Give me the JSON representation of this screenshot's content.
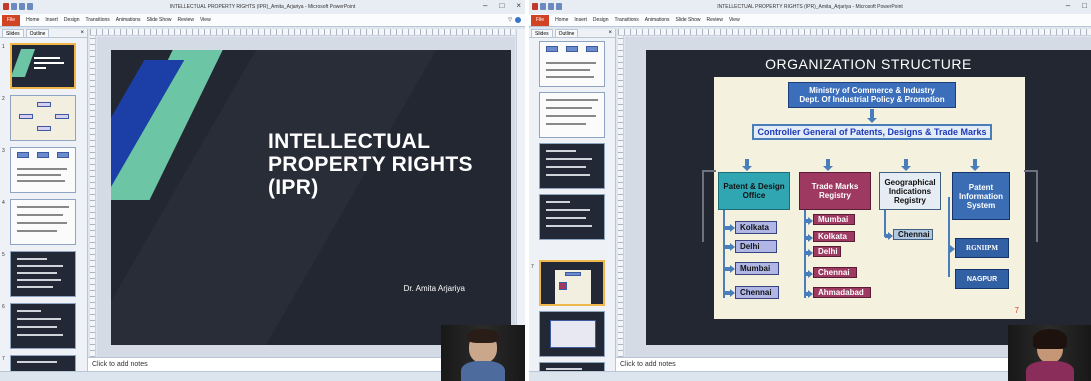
{
  "left": {
    "window_title": "INTELLECTUAL PROPERTY RIGHTS (IPR)_Amita_Arjariya - Microsoft PowerPoint",
    "ribbon_tabs": [
      "File",
      "Home",
      "Insert",
      "Design",
      "Transitions",
      "Animations",
      "Slide Show",
      "Review",
      "View"
    ],
    "panel_tabs": [
      "Slides",
      "Outline"
    ],
    "thumb_numbers": [
      "1",
      "2",
      "3",
      "4",
      "5",
      "6",
      "7"
    ],
    "slide_title": "INTELLECTUAL\nPROPERTY RIGHTS\n(IPR)",
    "author": "Dr. Amita Arjariya",
    "notes_placeholder": "Click to add notes",
    "window_controls": [
      "–",
      "□",
      "×"
    ]
  },
  "right": {
    "window_title": "INTELLECTUAL PROPERTY RIGHTS (IPR)_Amita_Arjariya - Microsoft PowerPoint",
    "ribbon_tabs": [
      "File",
      "Home",
      "Insert",
      "Design",
      "Transitions",
      "Animations",
      "Slide Show",
      "Review",
      "View"
    ],
    "panel_tabs": [
      "Slides",
      "Outline"
    ],
    "thumb_numbers": [
      "7"
    ],
    "notes_placeholder": "Click to add notes",
    "slide_title": "ORGANIZATION STRUCTURE",
    "ministry": "Ministry of Commerce & Industry\nDept. Of Industrial Policy & Promotion",
    "controller": "Controller General of Patents, Designs & Trade Marks",
    "branches": {
      "patent": {
        "label": "Patent & Design\nOffice",
        "items": [
          "Kolkata",
          "Delhi",
          "Mumbai",
          "Chennai"
        ]
      },
      "trademarks": {
        "label": "Trade Marks\nRegistry",
        "items": [
          "Mumbai",
          "Kolkata",
          "Delhi",
          "Chennai",
          "Ahmadabad"
        ]
      },
      "gi": {
        "label": "Geographical\nIndications\nRegistry",
        "items": [
          "Chennai"
        ]
      },
      "pis": {
        "label": "Patent\nInformation\nSystem",
        "items": [
          "RGNIIPM",
          "NAGPUR"
        ]
      }
    },
    "page_number": "7",
    "window_controls": [
      "–",
      "□"
    ]
  },
  "colors": {
    "slide_bg": "#222732",
    "accent_green": "#6cc5a4",
    "accent_blue": "#1b3fa6",
    "file_tab": "#d04423"
  }
}
